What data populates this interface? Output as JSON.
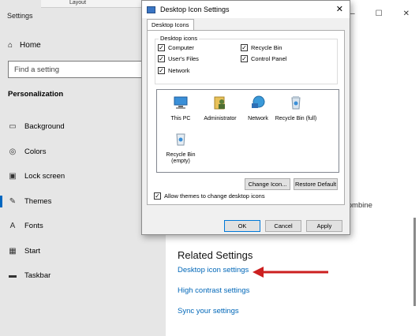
{
  "settings": {
    "window_title": "Settings",
    "home_label": "Home",
    "search_placeholder": "Find a setting",
    "section_title": "Personalization",
    "nav": [
      {
        "label": "Background",
        "icon": "picture-icon"
      },
      {
        "label": "Colors",
        "icon": "palette-icon"
      },
      {
        "label": "Lock screen",
        "icon": "lock-screen-icon"
      },
      {
        "label": "Themes",
        "icon": "brush-icon",
        "active": true
      },
      {
        "label": "Fonts",
        "icon": "font-icon"
      },
      {
        "label": "Start",
        "icon": "start-icon"
      },
      {
        "label": "Taskbar",
        "icon": "taskbar-icon"
      }
    ],
    "combine_text": "combine",
    "related": {
      "title": "Related Settings",
      "links": [
        "Desktop icon settings",
        "High contrast settings",
        "Sync your settings"
      ]
    },
    "top_strip_text": "Layout"
  },
  "dialog": {
    "title": "Desktop Icon Settings",
    "tab": "Desktop Icons",
    "group_label": "Desktop icons",
    "checkboxes": [
      {
        "label": "Computer",
        "checked": true
      },
      {
        "label": "User's Files",
        "checked": true
      },
      {
        "label": "Network",
        "checked": true
      },
      {
        "label": "Recycle Bin",
        "checked": true
      },
      {
        "label": "Control Panel",
        "checked": true
      }
    ],
    "icons": [
      {
        "label": "This PC",
        "icon": "monitor-icon"
      },
      {
        "label": "Administrator",
        "icon": "user-folder-icon"
      },
      {
        "label": "Network",
        "icon": "network-globe-icon"
      },
      {
        "label": "Recycle Bin (full)",
        "icon": "recycle-bin-full-icon"
      },
      {
        "label": "Recycle Bin (empty)",
        "icon": "recycle-bin-empty-icon"
      }
    ],
    "change_icon_label": "Change Icon...",
    "restore_default_label": "Restore Default",
    "allow_themes_label": "Allow themes to change desktop icons",
    "allow_themes_checked": true,
    "ok_label": "OK",
    "cancel_label": "Cancel",
    "apply_label": "Apply"
  },
  "colors": {
    "accent": "#0067c0",
    "link": "#0067b8",
    "arrow": "#cc1f1f"
  }
}
